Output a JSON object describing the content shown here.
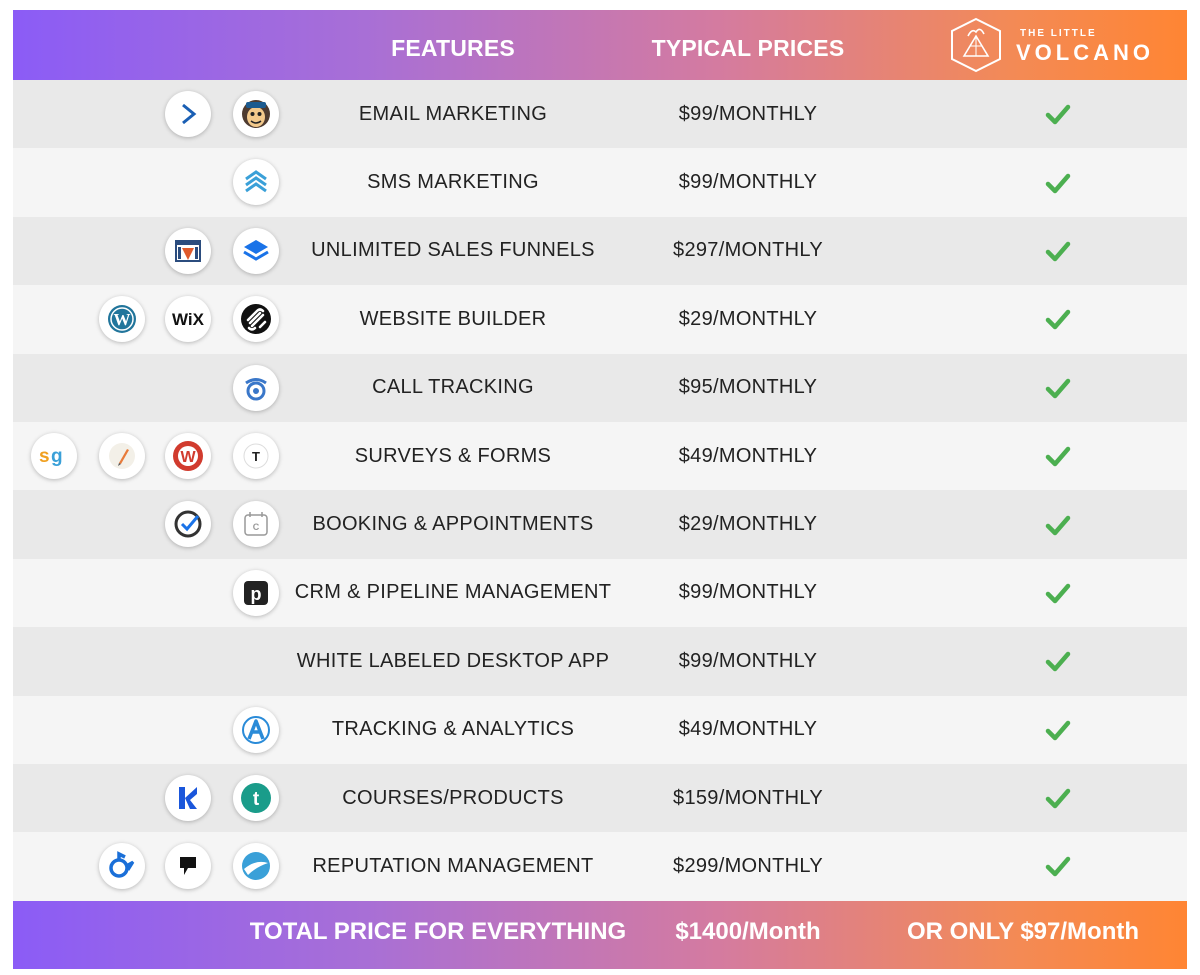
{
  "header": {
    "features_label": "FEATURES",
    "prices_label": "TYPICAL PRICES",
    "logo_small": "THE LITTLE",
    "logo_big": "VOLCANO"
  },
  "rows": [
    {
      "feature": "EMAIL MARKETING",
      "price": "$99/MONTHLY",
      "icons": [
        "activecampaign-icon",
        "mailchimp-icon"
      ]
    },
    {
      "feature": "SMS MARKETING",
      "price": "$99/MONTHLY",
      "icons": [
        "stack-chevrons-icon"
      ]
    },
    {
      "feature": "UNLIMITED SALES FUNNELS",
      "price": "$297/MONTHLY",
      "icons": [
        "clickfunnels-icon",
        "layers-icon"
      ]
    },
    {
      "feature": "WEBSITE BUILDER",
      "price": "$29/MONTHLY",
      "icons": [
        "wordpress-icon",
        "wix-icon",
        "squarespace-icon"
      ]
    },
    {
      "feature": "CALL TRACKING",
      "price": "$95/MONTHLY",
      "icons": [
        "callrail-icon"
      ]
    },
    {
      "feature": "SURVEYS & FORMS",
      "price": "$49/MONTHLY",
      "icons": [
        "surveygizmo-icon",
        "pen-icon",
        "wufoo-icon",
        "typeform-icon"
      ]
    },
    {
      "feature": "BOOKING & APPOINTMENTS",
      "price": "$29/MONTHLY",
      "icons": [
        "acuity-check-icon",
        "calendly-icon"
      ]
    },
    {
      "feature": "CRM & PIPELINE MANAGEMENT",
      "price": "$99/MONTHLY",
      "icons": [
        "pipedrive-icon"
      ]
    },
    {
      "feature": "WHITE LABELED DESKTOP APP",
      "price": "$99/MONTHLY",
      "icons": []
    },
    {
      "feature": "TRACKING & ANALYTICS",
      "price": "$49/MONTHLY",
      "icons": [
        "analytics-a-icon"
      ]
    },
    {
      "feature": "COURSES/PRODUCTS",
      "price": "$159/MONTHLY",
      "icons": [
        "kajabi-icon",
        "teachable-icon"
      ]
    },
    {
      "feature": "REPUTATION MANAGEMENT",
      "price": "$299/MONTHLY",
      "icons": [
        "birdeye-icon",
        "podium-icon",
        "swirl-icon"
      ]
    }
  ],
  "footer": {
    "label": "TOTAL PRICE FOR EVERYTHING",
    "total": "$1400/Month",
    "only": "OR ONLY $97/Month"
  },
  "colors": {
    "gradient_start": "#8b5cf6",
    "gradient_end": "#ff8533",
    "check": "#4caf50"
  }
}
